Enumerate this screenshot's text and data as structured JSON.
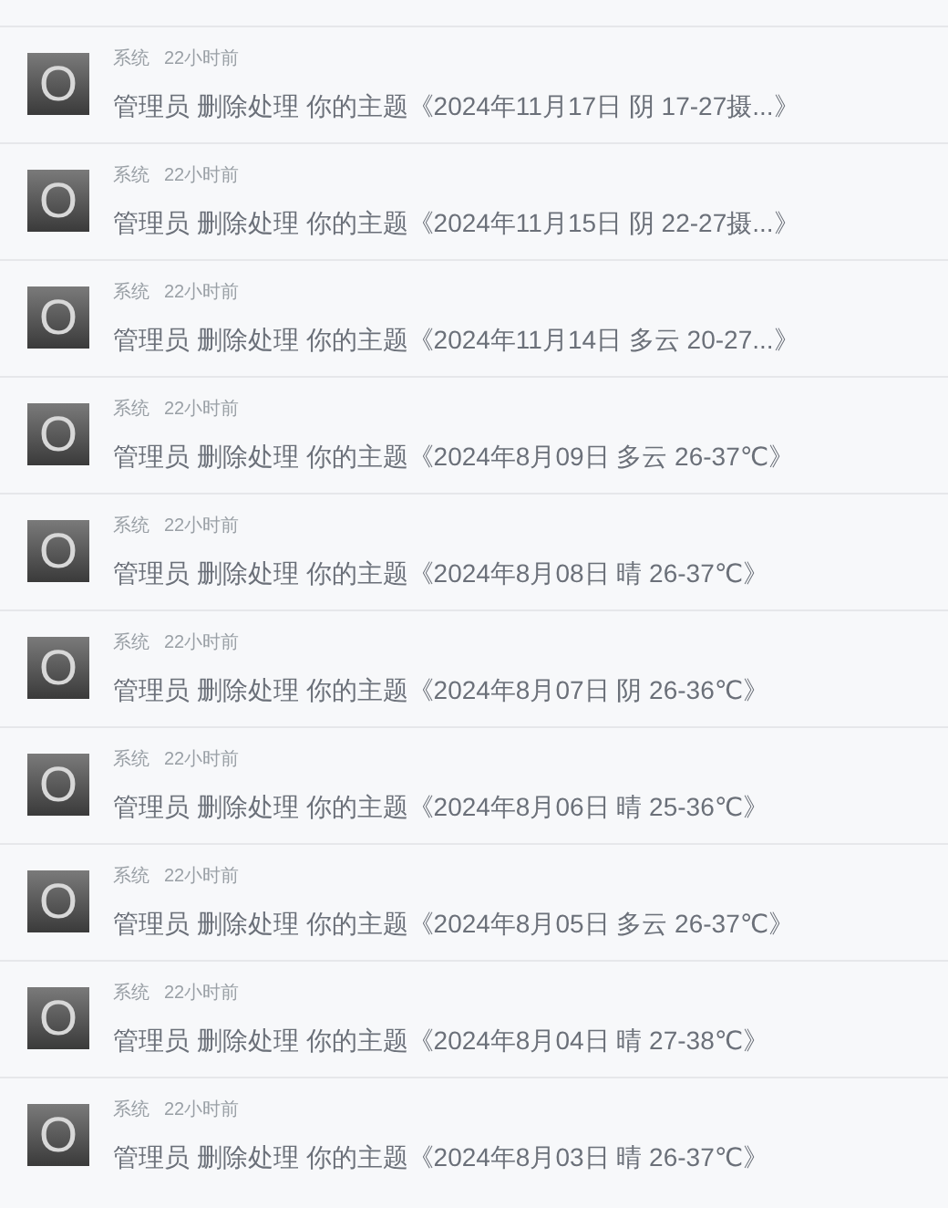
{
  "notifications": [
    {
      "avatar": "O",
      "sender": "系统",
      "time": "22小时前",
      "message": "管理员 删除处理 你的主题《2024年11月17日 阴 17-27摄...》"
    },
    {
      "avatar": "O",
      "sender": "系统",
      "time": "22小时前",
      "message": "管理员 删除处理 你的主题《2024年11月15日 阴 22-27摄...》"
    },
    {
      "avatar": "O",
      "sender": "系统",
      "time": "22小时前",
      "message": "管理员 删除处理 你的主题《2024年11月14日 多云 20-27...》"
    },
    {
      "avatar": "O",
      "sender": "系统",
      "time": "22小时前",
      "message": "管理员 删除处理 你的主题《2024年8月09日 多云 26-37℃》"
    },
    {
      "avatar": "O",
      "sender": "系统",
      "time": "22小时前",
      "message": "管理员 删除处理 你的主题《2024年8月08日 晴 26-37℃》"
    },
    {
      "avatar": "O",
      "sender": "系统",
      "time": "22小时前",
      "message": "管理员 删除处理 你的主题《2024年8月07日 阴 26-36℃》"
    },
    {
      "avatar": "O",
      "sender": "系统",
      "time": "22小时前",
      "message": "管理员 删除处理 你的主题《2024年8月06日 晴 25-36℃》"
    },
    {
      "avatar": "O",
      "sender": "系统",
      "time": "22小时前",
      "message": "管理员 删除处理 你的主题《2024年8月05日 多云 26-37℃》"
    },
    {
      "avatar": "O",
      "sender": "系统",
      "time": "22小时前",
      "message": "管理员 删除处理 你的主题《2024年8月04日 晴 27-38℃》"
    },
    {
      "avatar": "O",
      "sender": "系统",
      "time": "22小时前",
      "message": "管理员 删除处理 你的主题《2024年8月03日 晴 26-37℃》"
    }
  ]
}
